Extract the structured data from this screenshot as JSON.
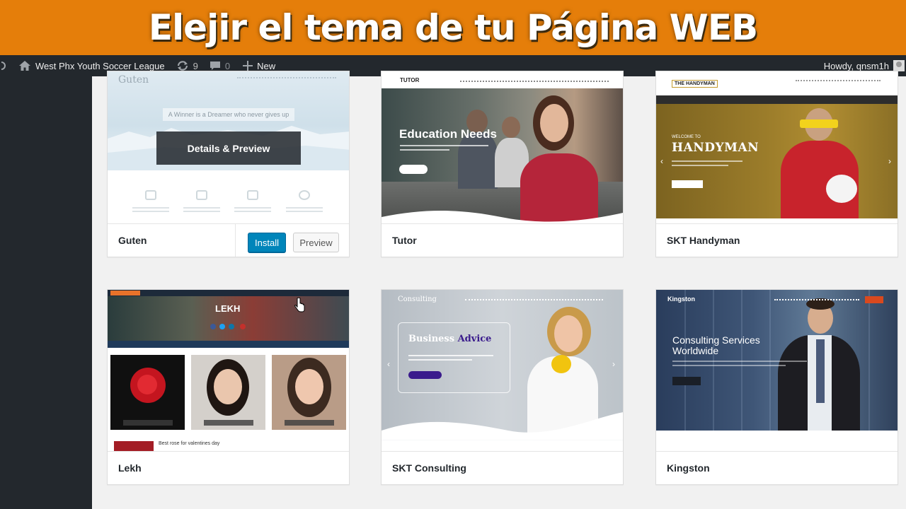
{
  "banner": {
    "title": "Elejir el tema de tu Página WEB"
  },
  "adminbar": {
    "site_name": "West Phx Youth Soccer League",
    "updates_count": "9",
    "comments_count": "0",
    "new_label": "New",
    "howdy": "Howdy, qnsm1h"
  },
  "themes": [
    {
      "name": "Guten",
      "details_label": "Details & Preview",
      "install_label": "Install",
      "preview_label": "Preview",
      "screenshot": {
        "logo": "Guten",
        "quote": "A Winner is a Dreamer who never gives up"
      }
    },
    {
      "name": "Tutor",
      "screenshot": {
        "logo": "TUTOR",
        "headline": "Education Needs"
      }
    },
    {
      "name": "SKT Handyman",
      "screenshot": {
        "logo": "THE HANDYMAN",
        "welcome": "WELCOME TO",
        "headline": "HANDYMAN"
      }
    },
    {
      "name": "Lekh",
      "screenshot": {
        "logo": "LEKH",
        "post_title": "Best rose for valentines day"
      }
    },
    {
      "name": "SKT Consulting",
      "screenshot": {
        "logo": "Consulting",
        "headline_a": "Business",
        "headline_b": "Advice"
      }
    },
    {
      "name": "Kingston",
      "screenshot": {
        "logo": "Kingston",
        "headline": "Consulting Services Worldwide"
      }
    }
  ],
  "colors": {
    "banner": "#e57e0a",
    "adminbar": "#23282d",
    "install": "#0085ba",
    "consulting_accent": "#3a1b8c",
    "kingston_accent": "#d9491e"
  },
  "icons": [
    "wordpress-icon",
    "home-icon",
    "updates-icon",
    "comments-icon",
    "plus-icon",
    "avatar",
    "cursor-icon"
  ]
}
